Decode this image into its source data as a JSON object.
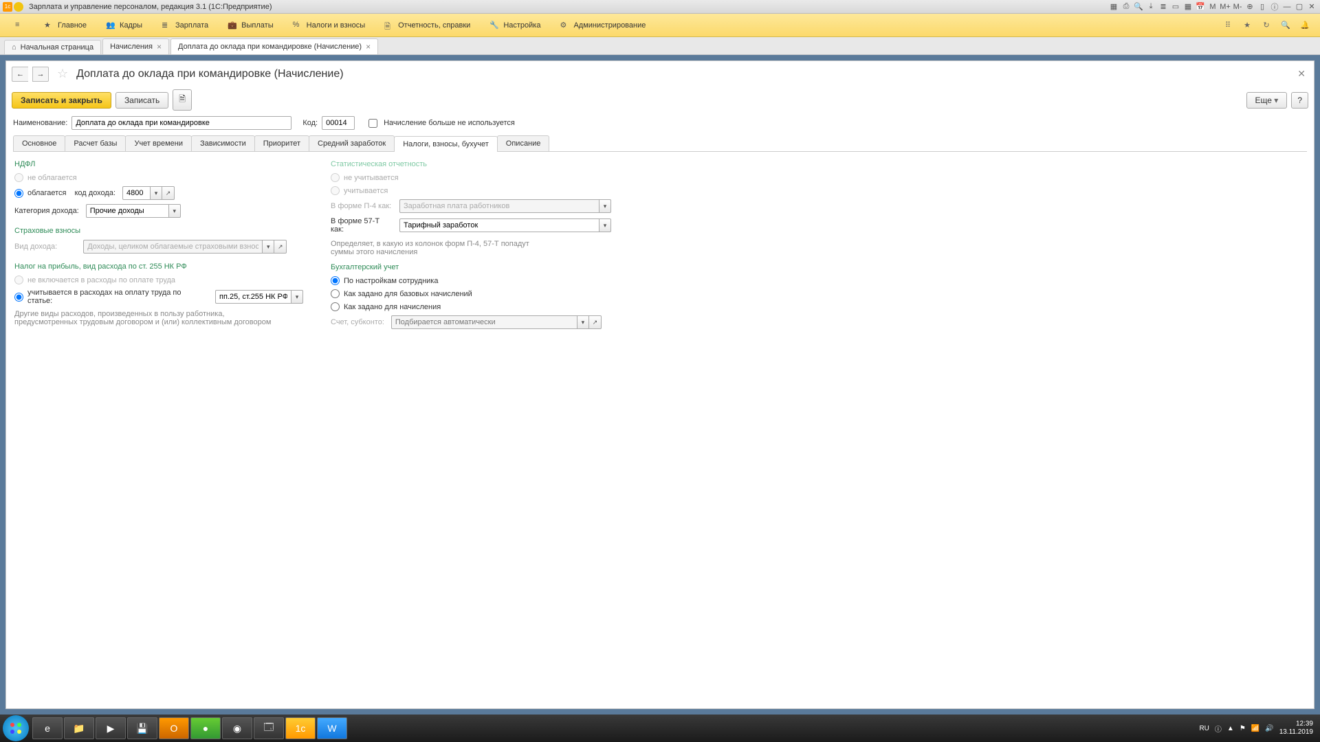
{
  "titlebar": {
    "title": "Зарплата и управление персоналом, редакция 3.1  (1С:Предприятие)"
  },
  "mainmenu": {
    "items": [
      "Главное",
      "Кадры",
      "Зарплата",
      "Выплаты",
      "Налоги и взносы",
      "Отчетность, справки",
      "Настройка",
      "Администрирование"
    ]
  },
  "tabs": {
    "home": "Начальная страница",
    "second": "Начисления",
    "third": "Доплата до оклада при командировке (Начисление)"
  },
  "page": {
    "title": "Доплата до оклада при командировке (Начисление)",
    "save_close": "Записать и закрыть",
    "save": "Записать",
    "more": "Еще",
    "help": "?",
    "name_label": "Наименование:",
    "name_value": "Доплата до оклада при командировке",
    "code_label": "Код:",
    "code_value": "00014",
    "unused_label": "Начисление больше не используется"
  },
  "formtabs": [
    "Основное",
    "Расчет базы",
    "Учет времени",
    "Зависимости",
    "Приоритет",
    "Средний заработок",
    "Налоги, взносы, бухучет",
    "Описание"
  ],
  "left": {
    "ndfl_title": "НДФЛ",
    "ndfl_no": "не облагается",
    "ndfl_yes": "облагается",
    "income_code_label": "код дохода:",
    "income_code": "4800",
    "category_label": "Категория дохода:",
    "category_value": "Прочие доходы",
    "insur_title": "Страховые взносы",
    "income_type_label": "Вид дохода:",
    "income_type_value": "Доходы, целиком облагаемые страховыми взносами",
    "profit_title": "Налог на прибыль, вид расхода по ст. 255 НК РФ",
    "profit_no": "не включается в расходы по оплате труда",
    "profit_yes": "учитывается в расходах на оплату труда по статье:",
    "profit_value": "пп.25, ст.255 НК РФ",
    "profit_help": "Другие виды расходов, произведенных в пользу работника, предусмотренных трудовым договором и (или) коллективным договором"
  },
  "right": {
    "stat_title": "Статистическая отчетность",
    "stat_no": "не учитывается",
    "stat_yes": "учитывается",
    "p4_label": "В форме П-4 как:",
    "p4_value": "Заработная плата работников",
    "t57_label": "В форме 57-Т как:",
    "t57_value": "Тарифный заработок",
    "stat_help": "Определяет, в какую из колонок форм П-4, 57-Т попадут суммы этого начисления",
    "acc_title": "Бухгалтерский учет",
    "acc_opt1": "По настройкам сотрудника",
    "acc_opt2": "Как задано для базовых начислений",
    "acc_opt3": "Как задано для начисления",
    "account_label": "Счет, субконто:",
    "account_placeholder": "Подбирается автоматически"
  },
  "taskbar": {
    "lang": "RU",
    "time": "12:39",
    "date": "13.11.2019"
  }
}
